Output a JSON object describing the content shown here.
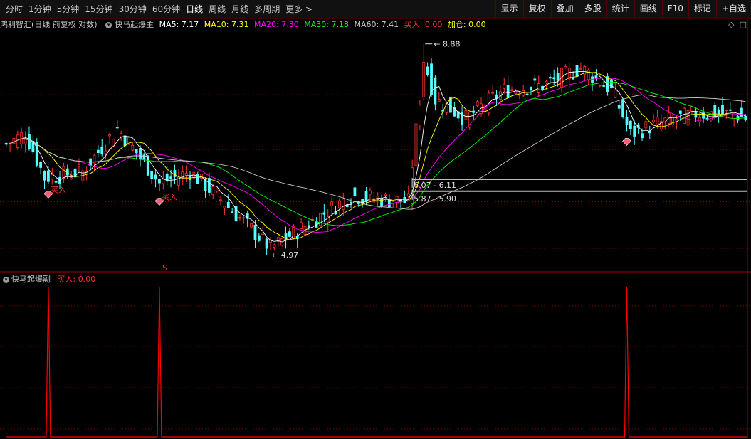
{
  "toolbar": {
    "periods": [
      {
        "label": "分时"
      },
      {
        "label": "1分钟"
      },
      {
        "label": "5分钟"
      },
      {
        "label": "15分钟"
      },
      {
        "label": "30分钟"
      },
      {
        "label": "60分钟"
      },
      {
        "label": "日线",
        "active": true
      },
      {
        "label": "周线"
      },
      {
        "label": "月线"
      },
      {
        "label": "多周期"
      },
      {
        "label": "更多 >"
      }
    ],
    "buttons": [
      {
        "label": "显示"
      },
      {
        "label": "复权"
      },
      {
        "label": "叠加"
      },
      {
        "label": "多股"
      },
      {
        "label": "统计"
      },
      {
        "label": "画线"
      },
      {
        "label": "F10"
      },
      {
        "label": "标记"
      },
      {
        "label": "+自选"
      }
    ]
  },
  "main_info": {
    "stock_name": "鸿利智汇(日线 前复权 对数)",
    "indicator_name": "快马起爆主",
    "ma5": "MA5: 7.17",
    "ma10": "MA10: 7.31",
    "ma20": "MA20: 7.30",
    "ma30": "MA30: 7.18",
    "ma60": "MA60: 7.41",
    "buy": "买入: 0.00",
    "add": "加仓: 0.00"
  },
  "sub_info": {
    "indicator_name": "快马起爆副",
    "buy": "买入: 0.00"
  },
  "annotations": {
    "high_label": "8.88",
    "low_label": "4.97",
    "zone1": "6.07 - 6.11",
    "zone2": "5.87 - 5.90",
    "buy_label": "买入",
    "s_marker": "S"
  },
  "colors": {
    "up": "#ff3232",
    "down": "#54ffff",
    "ma5": "#ffffff",
    "ma10": "#ffff00",
    "ma20": "#ff00ff",
    "ma30": "#00ff00",
    "ma60": "#c8c8c8",
    "grid": "#8b0000",
    "sub_line": "#ff0000"
  },
  "chart_data": {
    "type": "candlestick",
    "y_scale": "log",
    "ylim": [
      4.7,
      9.2
    ],
    "highest": 8.88,
    "lowest": 4.97,
    "buy_signal_bars": [
      11,
      40,
      162
    ],
    "price_zones": [
      [
        6.07,
        6.11
      ],
      [
        5.87,
        5.9
      ]
    ],
    "ohlc_keypoints": [
      {
        "bar": 0,
        "close": 6.7
      },
      {
        "bar": 5,
        "close": 6.9
      },
      {
        "bar": 10,
        "close": 6.1
      },
      {
        "bar": 20,
        "close": 6.2
      },
      {
        "bar": 29,
        "close": 7.0
      },
      {
        "bar": 40,
        "close": 6.0
      },
      {
        "bar": 48,
        "close": 6.2
      },
      {
        "bar": 60,
        "close": 5.5
      },
      {
        "bar": 69,
        "close": 5.0
      },
      {
        "bar": 80,
        "close": 5.4
      },
      {
        "bar": 90,
        "close": 5.8
      },
      {
        "bar": 105,
        "close": 5.7
      },
      {
        "bar": 108,
        "close": 7.6
      },
      {
        "bar": 109,
        "close": 8.5
      },
      {
        "bar": 112,
        "close": 7.6
      },
      {
        "bar": 120,
        "close": 7.2
      },
      {
        "bar": 130,
        "close": 7.8
      },
      {
        "bar": 140,
        "close": 7.9
      },
      {
        "bar": 150,
        "close": 8.3
      },
      {
        "bar": 158,
        "close": 7.8
      },
      {
        "bar": 163,
        "close": 6.9
      },
      {
        "bar": 170,
        "close": 7.1
      },
      {
        "bar": 180,
        "close": 7.3
      },
      {
        "bar": 190,
        "close": 7.3
      },
      {
        "bar": 193,
        "close": 7.2
      }
    ],
    "spike_high_bar": 109,
    "low_bar": 69,
    "sub_indicator": {
      "type": "line",
      "name": "买入",
      "spike_bars": [
        11,
        40,
        162
      ],
      "baseline": 0
    }
  }
}
